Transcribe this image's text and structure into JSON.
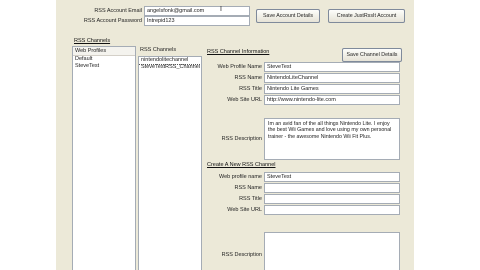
{
  "account": {
    "email_label": "RSS Account Email",
    "email_value": "angelsfonk@gmail.com",
    "password_label": "RSS Account Password",
    "password_value": "Intrepid123",
    "save_button": "Save Account Details",
    "create_button": "Create JustRssIt Account"
  },
  "rss_channels": {
    "section_title": "RSS Channels",
    "profile_column": "Web Profiles",
    "profiles": [
      "Default",
      "SteveTest"
    ],
    "channels_column": "RSS Channels",
    "channels": [
      "nintendolitechannel",
      "SteveTestRSS_Channel"
    ]
  },
  "channel_info": {
    "section_title": "RSS Channel Information",
    "save_button": "Save Channel Details",
    "fields": {
      "web_profile_name": {
        "label": "Web Profile Name",
        "value": "SteveTest"
      },
      "rss_name": {
        "label": "RSS Name",
        "value": "NintendoLiteChannel"
      },
      "rss_title": {
        "label": "RSS Title",
        "value": "Nintendo Lite Games"
      },
      "web_site_url": {
        "label": "Web Site URL",
        "value": "http://www.nintendo-lite.com"
      },
      "rss_description": {
        "label": "RSS Description",
        "value": "Im an avid fan of the all things Nintendo Lite. I enjoy the best Wii Games and love using my own personal trainer - the awesome Nintendo Wii Fit Plus."
      }
    }
  },
  "new_channel": {
    "section_title": "Create A New RSS Channel",
    "fields": {
      "web_profile_name": {
        "label": "Web profile name",
        "value": "SteveTest"
      },
      "rss_name": {
        "label": "RSS Name",
        "value": ""
      },
      "rss_title": {
        "label": "RSS Title",
        "value": ""
      },
      "web_site_url": {
        "label": "Web Site URL",
        "value": ""
      },
      "rss_description": {
        "label": "RSS Description",
        "value": ""
      }
    }
  }
}
